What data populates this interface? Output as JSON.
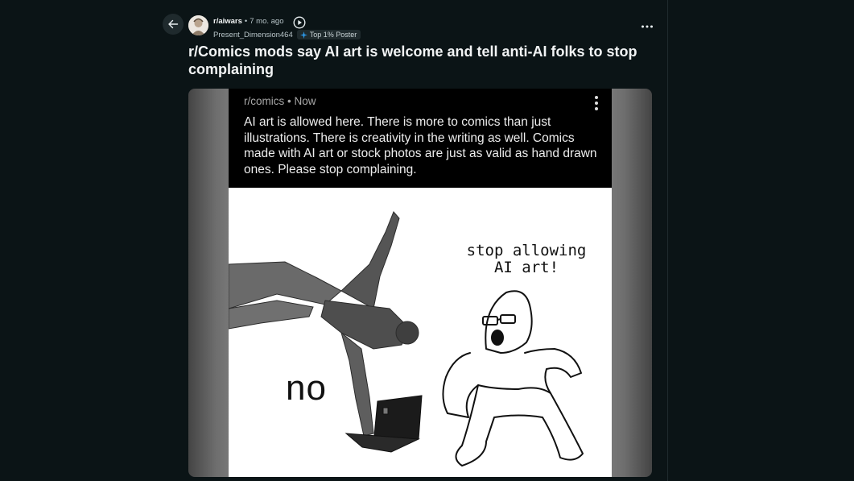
{
  "post": {
    "subreddit": "r/aiwars",
    "separator": "•",
    "time_ago": "7 mo. ago",
    "author": "Present_Dimension464",
    "flair": "Top 1% Poster",
    "title": "r/Comics mods say AI art is welcome and tell anti-AI folks to stop complaining"
  },
  "icons": {
    "back": "arrow-left-icon",
    "play": "play-circle-icon",
    "more": "more-horizontal-icon",
    "flair": "sparkle-icon"
  },
  "media": {
    "screenshot": {
      "subreddit": "r/comics",
      "separator": "•",
      "time": "Now",
      "body": "AI art is allowed here. There is more to comics than just illustrations. There is creativity in the writing as well. Comics made with AI art or stock photos are just as valid as hand drawn ones. Please stop complaining."
    },
    "meme": {
      "left_caption": "no",
      "right_caption_line1": "stop allowing",
      "right_caption_line2": "AI art!"
    }
  },
  "colors": {
    "background": "#0b1416",
    "flair_bg": "#1f2a2d",
    "flair_icon": "#2d9cf0",
    "text_primary": "#f2f4f5"
  }
}
